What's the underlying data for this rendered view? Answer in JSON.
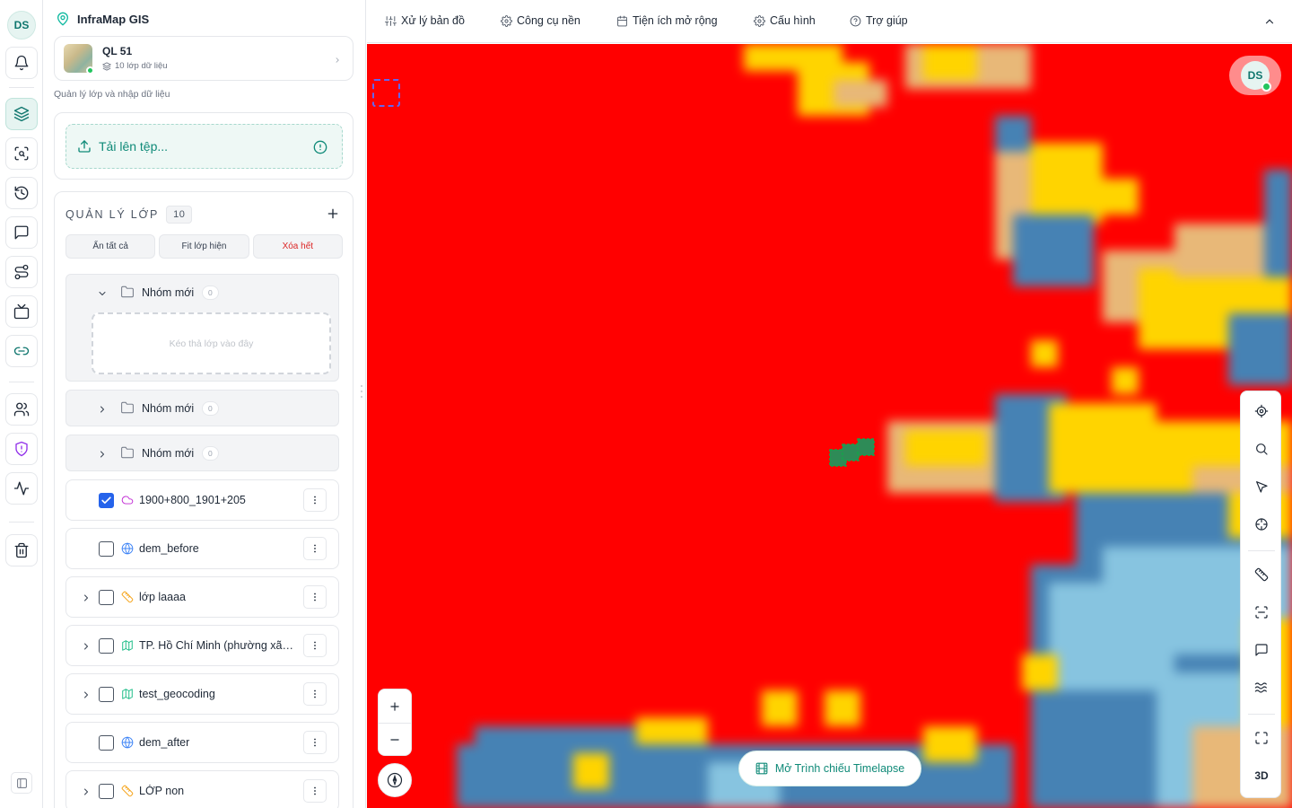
{
  "user": {
    "initials": "DS"
  },
  "brand": {
    "name": "InfraMap GIS"
  },
  "project": {
    "name": "QL 51",
    "meta": "10 lớp dữ liệu"
  },
  "subtitle": "Quản lý lớp và nhập dữ liệu",
  "upload": {
    "label": "Tải lên tệp..."
  },
  "layers": {
    "heading": "QUẢN LÝ LỚP",
    "count": "10",
    "actions": {
      "hide_all": "Ẩn tất cả",
      "fit_visible": "Fit lớp hiện",
      "delete_all": "Xóa hết"
    },
    "groups": [
      {
        "name": "Nhóm mới",
        "count": "0",
        "expanded": true,
        "drop_hint": "Kéo thả lớp vào đây"
      },
      {
        "name": "Nhóm mới",
        "count": "0",
        "expanded": false
      },
      {
        "name": "Nhóm mới",
        "count": "0",
        "expanded": false
      }
    ],
    "items": [
      {
        "name": "1900+800_1901+205",
        "checked": true,
        "type": "cloud",
        "expandable": false
      },
      {
        "name": "dem_before",
        "checked": false,
        "type": "globe",
        "expandable": false
      },
      {
        "name": "lớp laaaa",
        "checked": false,
        "type": "ruler",
        "expandable": true
      },
      {
        "name": "TP. Hồ Chí Minh (phường xã) -...",
        "checked": false,
        "type": "map",
        "expandable": true
      },
      {
        "name": "test_geocoding",
        "checked": false,
        "type": "map",
        "expandable": true
      },
      {
        "name": "dem_after",
        "checked": false,
        "type": "globe",
        "expandable": false
      },
      {
        "name": "LỚP non",
        "checked": false,
        "type": "ruler",
        "expandable": true
      }
    ]
  },
  "menubar": {
    "items": [
      {
        "label": "Xử lý bản đồ",
        "icon": "sliders-icon"
      },
      {
        "label": "Công cụ nền",
        "icon": "gear-icon"
      },
      {
        "label": "Tiện ích mở rộng",
        "icon": "calendar-icon"
      },
      {
        "label": "Cấu hình",
        "icon": "gear-icon"
      },
      {
        "label": "Trợ giúp",
        "icon": "help-icon"
      }
    ]
  },
  "map": {
    "timelapse_label": "Mở Trình chiếu Timelapse",
    "tools_3d_label": "3D",
    "raster_colors": {
      "high": "#ff0000",
      "mid": "#ffd400",
      "sand": "#e8b878",
      "blue": "#4682b4",
      "light": "#87c4e0"
    }
  }
}
